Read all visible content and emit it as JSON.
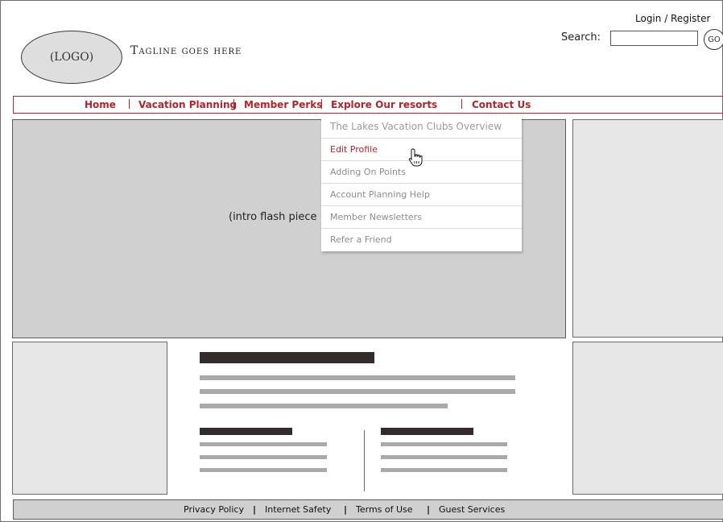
{
  "header": {
    "logo_text": "(LOGO)",
    "tagline": "Tagline goes here",
    "login_link": "Login / Register",
    "search_label": "Search:",
    "search_value": "",
    "go_label": "GO"
  },
  "nav": {
    "items": [
      "Home",
      "Vacation Planning",
      "Member Perks",
      "Explore Our resorts",
      "Contact Us"
    ],
    "accent_color": "#b0242b"
  },
  "dropdown": {
    "items": [
      "The Lakes Vacation Clubs Overview",
      "Edit Profile",
      "Adding On Points",
      "Account Planning Help",
      "Member Newsletters",
      "Refer a Friend"
    ],
    "hovered_item": "Edit Profile"
  },
  "main": {
    "flash_placeholder": "(intro flash piece"
  },
  "footer": {
    "links": [
      "Privacy Policy",
      "Internet Safety",
      "Terms of Use",
      "Guest Services"
    ],
    "separator": "|"
  },
  "icons": {
    "cursor": "hand-pointer-icon"
  }
}
